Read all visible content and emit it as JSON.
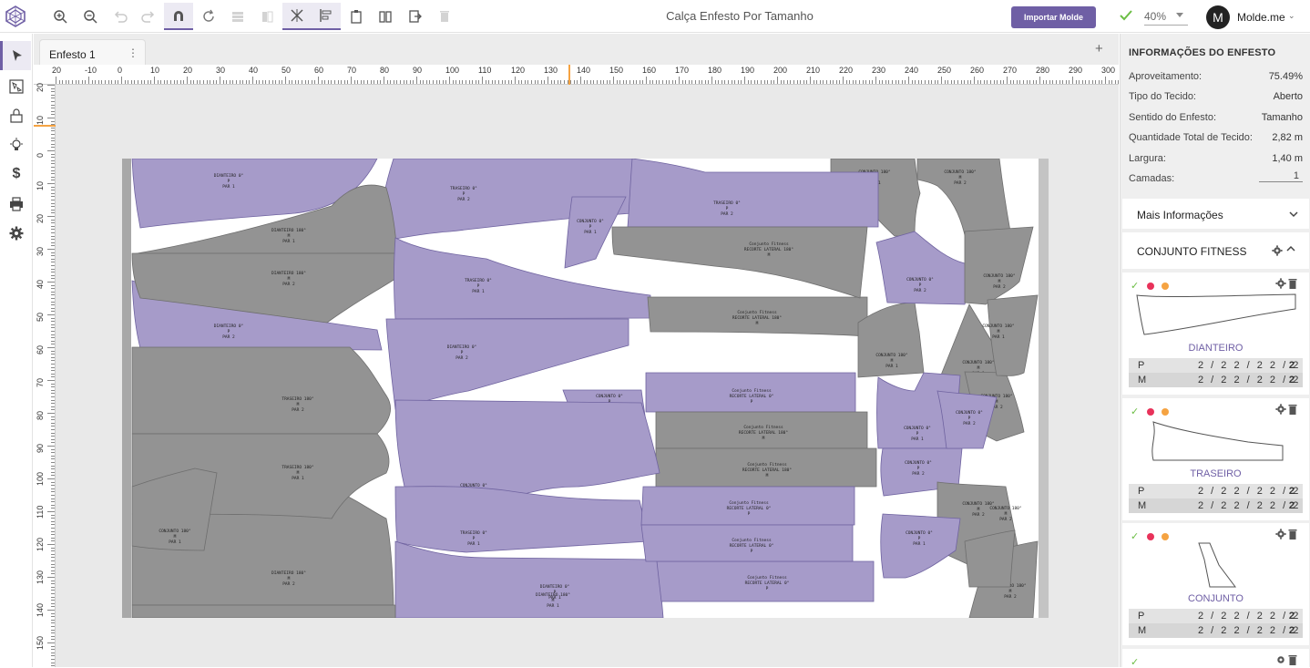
{
  "app": {
    "document_title": "Calça Enfesto Por Tamanho",
    "import_button": "Importar Molde",
    "zoom_value": "40%",
    "user_initial": "M",
    "user_name": "Molde.me"
  },
  "toolbar": [
    "zoom-in-icon",
    "zoom-out-icon",
    "undo-icon",
    "redo-icon",
    "magnet-icon",
    "rotate-icon",
    "layers-icon",
    "mirror-icon",
    "cut-icon",
    "align-icon",
    "clipboard-icon",
    "flip-icon",
    "export-icon",
    "trash-icon"
  ],
  "left_tools": [
    "pointer-icon",
    "layout-icon",
    "lock-icon",
    "bulb-icon",
    "dollar-icon",
    "print-icon",
    "settings-icon"
  ],
  "tabs": [
    {
      "label": "Enfesto 1",
      "menu": "⋮"
    }
  ],
  "add_tab": "+",
  "ruler": {
    "h_ticks": [
      "20",
      "-10",
      "0",
      "10",
      "20",
      "30",
      "40",
      "50",
      "60",
      "70",
      "80",
      "90",
      "100",
      "110",
      "120",
      "130",
      "140",
      "150",
      "160",
      "170",
      "180",
      "190",
      "200",
      "210",
      "220",
      "230",
      "240",
      "250",
      "260",
      "270",
      "280",
      "290",
      "300"
    ],
    "v_ticks": [
      "20",
      "10",
      "0",
      "10",
      "20",
      "30",
      "40",
      "50",
      "60",
      "70",
      "80",
      "90",
      "100",
      "110",
      "120",
      "130",
      "140",
      "150"
    ]
  },
  "canvas": {
    "piece_colors": {
      "purple": "#a69bc9",
      "gray": "#939393"
    },
    "pieces": [
      {
        "label": "DIANTEIRO 0°",
        "l2": "P",
        "l3": "PAR 1",
        "c": "purple"
      },
      {
        "label": "TRASEIRO 0°",
        "l2": "P",
        "l3": "PAR 2",
        "c": "purple"
      },
      {
        "label": "DIANTEIRO 0°",
        "l2": "P",
        "l3": "PAR 2",
        "c": "purple"
      },
      {
        "label": "CONJUNTO 0°",
        "l2": "P",
        "l3": "PAR 1",
        "c": "purple"
      },
      {
        "label": "CONJUNTO 180°",
        "l2": "M",
        "l3": "PAR 1",
        "c": "gray"
      },
      {
        "label": "CONJUNTO 180°",
        "l2": "M",
        "l3": "PAR 2",
        "c": "gray"
      },
      {
        "label": "DIANTEIRO 180°",
        "l2": "M",
        "l3": "PAR 1",
        "c": "gray"
      },
      {
        "label": "DIANTEIRO 180°",
        "l2": "M",
        "l3": "PAR 2",
        "c": "gray"
      },
      {
        "label": "DIANTEIRO 180°",
        "l2": "M",
        "l3": "PAR 2",
        "c": "gray"
      },
      {
        "label": "TRASEIRO 0°",
        "l2": "P",
        "l3": "PAR 1",
        "c": "purple"
      },
      {
        "label": "CONJUNTO 0°",
        "l2": "P",
        "l3": "PAR 1",
        "c": "purple"
      },
      {
        "label": "DIANTEIRO 0°",
        "l2": "P",
        "l3": "PAR 2",
        "c": "purple"
      },
      {
        "label": "Conjunto Fitness",
        "l2": "RECORTE LATERAL 180°",
        "l3": "M",
        "c": "gray"
      },
      {
        "label": "CONJUNTO 180°",
        "l2": "M",
        "l3": "PAR 1",
        "c": "gray"
      },
      {
        "label": "CONJUNTO 0°",
        "l2": "P",
        "l3": "PAR 2",
        "c": "purple"
      },
      {
        "label": "TRASEIRO 0°",
        "l2": "P",
        "l3": "PAR 2",
        "c": "purple"
      },
      {
        "label": "Conjunto Fitness",
        "l2": "RECORTE LATERAL 180°",
        "l3": "M",
        "c": "gray"
      },
      {
        "label": "CONJUNTO 180°",
        "l2": "M",
        "l3": "PAR 2",
        "c": "gray"
      },
      {
        "label": "CONJUNTO 180°",
        "l2": "M",
        "l3": "PAR 1",
        "c": "gray"
      },
      {
        "label": "Conjunto Fitness",
        "l2": "RECORTE LATERAL 0°",
        "l3": "P",
        "c": "purple"
      },
      {
        "label": "TRASEIRO 180°",
        "l2": "M",
        "l3": "PAR 2",
        "c": "gray"
      },
      {
        "label": "TRASEIRO 180°",
        "l2": "M",
        "l3": "PAR 1",
        "c": "gray"
      },
      {
        "label": "Conjunto Fitness",
        "l2": "RECORTE LATERAL 180°",
        "l3": "M",
        "c": "gray"
      },
      {
        "label": "CONJUNTO 0°",
        "l2": "P",
        "l3": "PAR 1",
        "c": "purple"
      },
      {
        "label": "CONJUNTO 0°",
        "l2": "P",
        "l3": "PAR 2",
        "c": "purple"
      },
      {
        "label": "Conjunto Fitness",
        "l2": "RECORTE LATERAL 180°",
        "l3": "M",
        "c": "gray"
      },
      {
        "label": "CONJUNTO 0°",
        "l2": "P",
        "l3": "PAR 1",
        "c": "purple"
      },
      {
        "label": "CONJUNTO 180°",
        "l2": "M",
        "l3": "PAR 2",
        "c": "gray"
      },
      {
        "label": "TRASEIRO 0°",
        "l2": "P",
        "l3": "PAR 1",
        "c": "purple"
      },
      {
        "label": "Conjunto Fitness",
        "l2": "RECORTE LATERAL 0°",
        "l3": "P",
        "c": "purple"
      },
      {
        "label": "CONJUNTO 180°",
        "l2": "M",
        "l3": "PAR 2",
        "c": "gray"
      },
      {
        "label": "CONJUNTO 0°",
        "l2": "P",
        "l3": "PAR 1",
        "c": "purple"
      },
      {
        "label": "DIANTEIRO 0°",
        "l2": "P",
        "l3": "PAR 1",
        "c": "purple"
      },
      {
        "label": "Conjunto Fitness",
        "l2": "RECORTE LATERAL 0°",
        "l3": "P",
        "c": "purple"
      },
      {
        "label": "CONJUNTO 180°",
        "l2": "M",
        "l3": "PAR 1",
        "c": "gray"
      },
      {
        "label": "Conjunto Fitness",
        "l2": "RECORTE LATERAL 0°",
        "l3": "P",
        "c": "purple"
      },
      {
        "label": "CONJUNTO 0°",
        "l2": "P",
        "l3": "PAR 2",
        "c": "purple"
      },
      {
        "label": "CONJUNTO 180°",
        "l2": "M",
        "l3": "PAR 1",
        "c": "gray"
      },
      {
        "label": "TRASEIRO 180°",
        "l2": "M",
        "l3": "PAR 2",
        "c": "gray"
      },
      {
        "label": "DIANTEIRO 180°",
        "l2": "M",
        "l3": "PAR 1",
        "c": "gray"
      },
      {
        "label": "CONJUNTO 180°",
        "l2": "M",
        "l3": "PAR 2",
        "c": "gray"
      }
    ]
  },
  "panel": {
    "title": "INFORMAÇÕES DO ENFESTO",
    "info": [
      {
        "label": "Aproveitamento:",
        "value": "75.49%"
      },
      {
        "label": "Tipo do Tecido:",
        "value": "Aberto"
      },
      {
        "label": "Sentido do Enfesto:",
        "value": "Tamanho"
      },
      {
        "label": "Quantidade Total de Tecido:",
        "value": "2,82 m"
      },
      {
        "label": "Largura:",
        "value": "1,40 m"
      }
    ],
    "layers_label": "Camadas:",
    "layers_value": "1",
    "more_info": "Mais Informações",
    "group": "CONJUNTO FITNESS",
    "molds": [
      {
        "name": "DIANTEIRO",
        "sizes": [
          {
            "size": "P",
            "qty": "2 / 2 2 / 2 2 / 2",
            "total": "2"
          },
          {
            "size": "M",
            "qty": "2 / 2 2 / 2 2 / 2",
            "total": "2"
          }
        ]
      },
      {
        "name": "TRASEIRO",
        "sizes": [
          {
            "size": "P",
            "qty": "2 / 2 2 / 2 2 / 2",
            "total": "2"
          },
          {
            "size": "M",
            "qty": "2 / 2 2 / 2 2 / 2",
            "total": "2"
          }
        ]
      },
      {
        "name": "CONJUNTO",
        "sizes": [
          {
            "size": "P",
            "qty": "2 / 2 2 / 2 2 / 2",
            "total": "2"
          },
          {
            "size": "M",
            "qty": "2 / 2 2 / 2 2 / 2",
            "total": "2"
          }
        ]
      }
    ],
    "dot_colors": [
      "#e8325a",
      "#f5a342"
    ],
    "check_color": "#6cbe45"
  },
  "accent": "#6f5fa5"
}
